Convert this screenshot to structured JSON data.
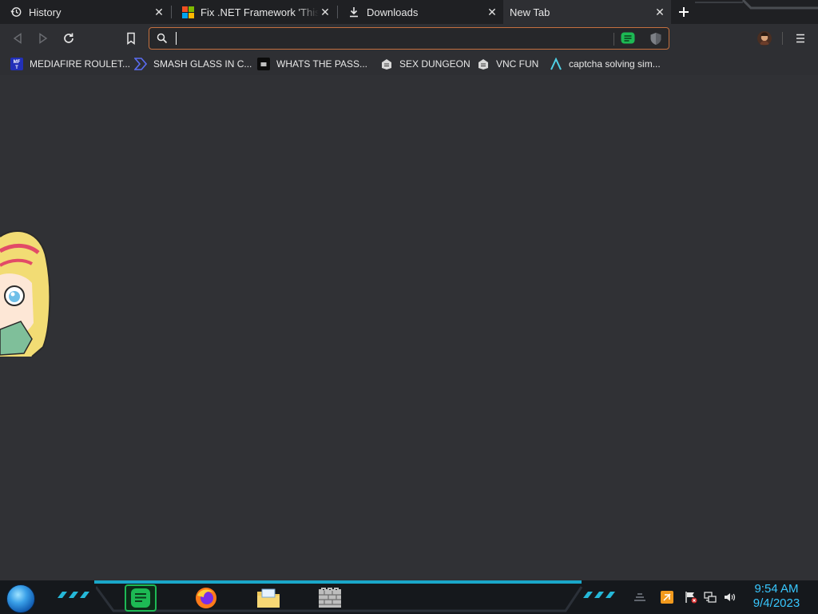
{
  "tabs": [
    {
      "title": "History",
      "icon": "history-icon"
    },
    {
      "title": "Fix .NET Framework 'This app",
      "icon": "microsoft-logo-icon"
    },
    {
      "title": "Downloads",
      "icon": "download-icon"
    },
    {
      "title": "New Tab",
      "icon": ""
    }
  ],
  "address_bar": {
    "value": "",
    "placeholder": ""
  },
  "bookmarks": [
    {
      "label": "MEDIAFIRE ROULET...",
      "icon": "mediafire-icon"
    },
    {
      "label": "SMASH GLASS IN C...",
      "icon": "chevron-logo-icon"
    },
    {
      "label": "WHATS THE PASS...",
      "icon": "dark-square-icon"
    },
    {
      "label": "SEX DUNGEON",
      "icon": "dungeon-icon"
    },
    {
      "label": "VNC FUN",
      "icon": "dungeon-icon"
    },
    {
      "label": "captcha solving sim...",
      "icon": "lambda-icon"
    }
  ],
  "taskbar": {
    "apps": [
      "notes-app-icon",
      "firefox-icon",
      "file-explorer-icon",
      "wall-app-icon"
    ],
    "clock": {
      "time": "9:54 AM",
      "date": "9/4/2023"
    }
  },
  "colors": {
    "accent": "#c4703f",
    "clock": "#38c8ff",
    "taskbar_glow": "#1aa7c9"
  }
}
